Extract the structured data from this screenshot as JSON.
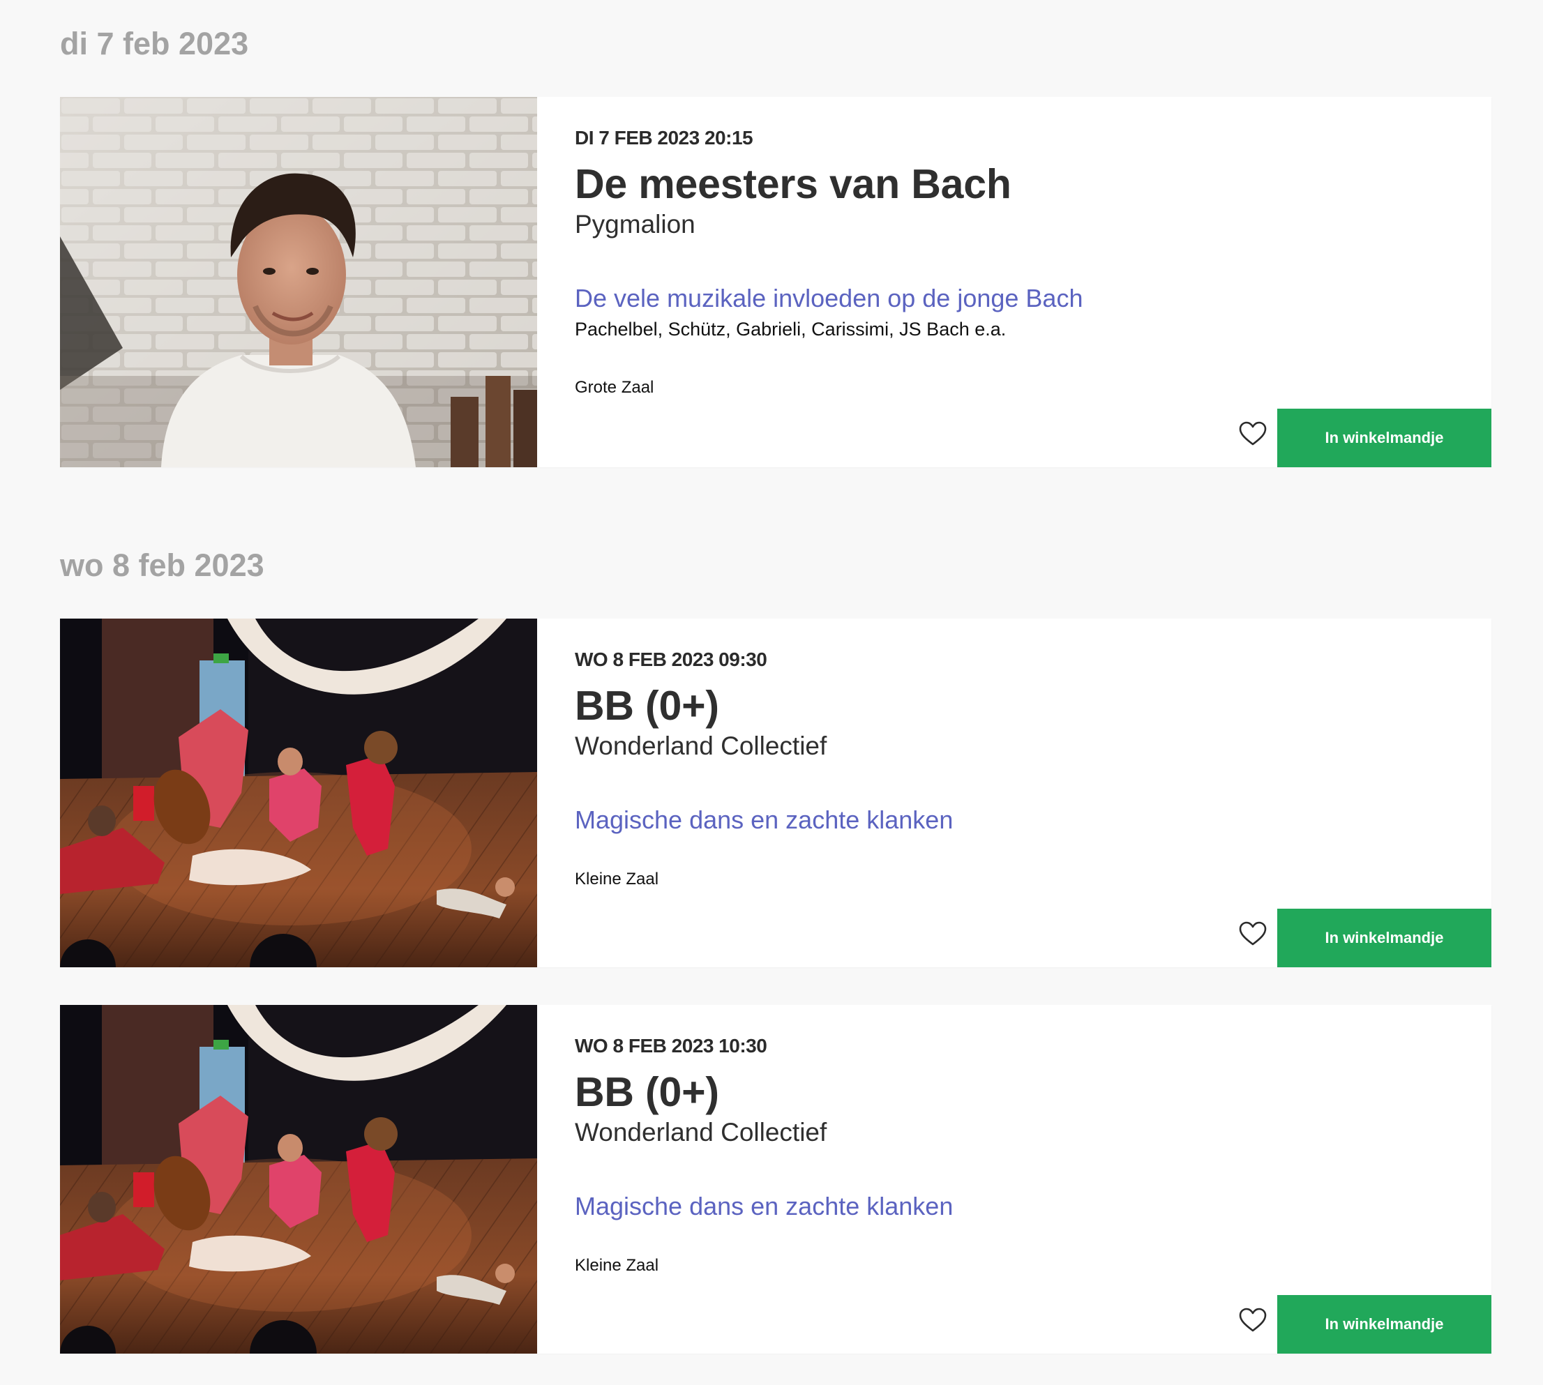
{
  "days": [
    {
      "heading": "di 7 feb 2023",
      "events": [
        {
          "datetime": "DI 7 FEB 2023 20:15",
          "title": "De meesters van Bach",
          "performer": "Pygmalion",
          "tagline": "De vele muzikale invloeden op de jonge Bach",
          "composers": "Pachelbel, Schütz, Gabrieli, Carissimi, JS Bach e.a.",
          "venue": "Grote Zaal",
          "cart_label": "In winkelmandje",
          "image": "portrait-photo"
        }
      ]
    },
    {
      "heading": "wo 8 feb 2023",
      "events": [
        {
          "datetime": "WO 8 FEB 2023 09:30",
          "title": "BB (0+)",
          "performer": "Wonderland Collectief",
          "tagline": "Magische dans en zachte klanken",
          "venue": "Kleine Zaal",
          "cart_label": "In winkelmandje",
          "image": "stage-performance-photo"
        },
        {
          "datetime": "WO 8 FEB 2023 10:30",
          "title": "BB (0+)",
          "performer": "Wonderland Collectief",
          "tagline": "Magische dans en zachte klanken",
          "venue": "Kleine Zaal",
          "cart_label": "In winkelmandje",
          "image": "stage-performance-photo"
        }
      ]
    }
  ],
  "icons": {
    "favorite": "heart-outline-icon"
  },
  "colors": {
    "background": "#f8f8f8",
    "heading": "#a3a3a3",
    "tagline": "#5b63c0",
    "cart_button": "#21a85a"
  }
}
